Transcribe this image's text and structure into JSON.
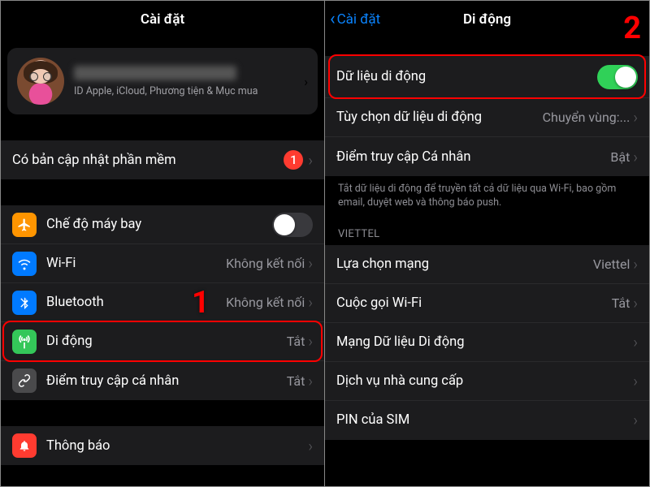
{
  "left": {
    "nav_title": "Cài đặt",
    "profile_sub": "ID Apple, iCloud, Phương tiện & Mục mua",
    "update_row": {
      "label": "Có bản cập nhật phần mềm",
      "badge": "1"
    },
    "rows": {
      "airplane": {
        "label": "Chế độ máy bay"
      },
      "wifi": {
        "label": "Wi-Fi",
        "value": "Không kết nối"
      },
      "bluetooth": {
        "label": "Bluetooth",
        "value": "Không kết nối"
      },
      "cellular": {
        "label": "Di động",
        "value": "Tắt"
      },
      "hotspot": {
        "label": "Điểm truy cập cá nhân",
        "value": "Tắt"
      },
      "notif": {
        "label": "Thông báo"
      }
    },
    "step_number": "1"
  },
  "right": {
    "back_label": "Cài đặt",
    "nav_title": "Di động",
    "rows": {
      "data": {
        "label": "Dữ liệu di động"
      },
      "options": {
        "label": "Tùy chọn dữ liệu di động",
        "value": "Chuyển vùng:..."
      },
      "hotspot": {
        "label": "Điểm truy cập Cá nhân",
        "value": "Bật"
      },
      "net_select": {
        "label": "Lựa chọn mạng",
        "value": "Viettel"
      },
      "wifi_call": {
        "label": "Cuộc gọi Wi-Fi",
        "value": "Tắt"
      },
      "data_net": {
        "label": "Mạng Dữ liệu Di động"
      },
      "carrier_svc": {
        "label": "Dịch vụ nhà cung cấp"
      },
      "sim_pin": {
        "label": "PIN của SIM"
      }
    },
    "note": "Tắt dữ liệu di động để truyền tất cả dữ liệu qua Wi-Fi, bao gồm email, duyệt web và thông báo push.",
    "carrier_header": "VIETTEL",
    "step_number": "2"
  }
}
